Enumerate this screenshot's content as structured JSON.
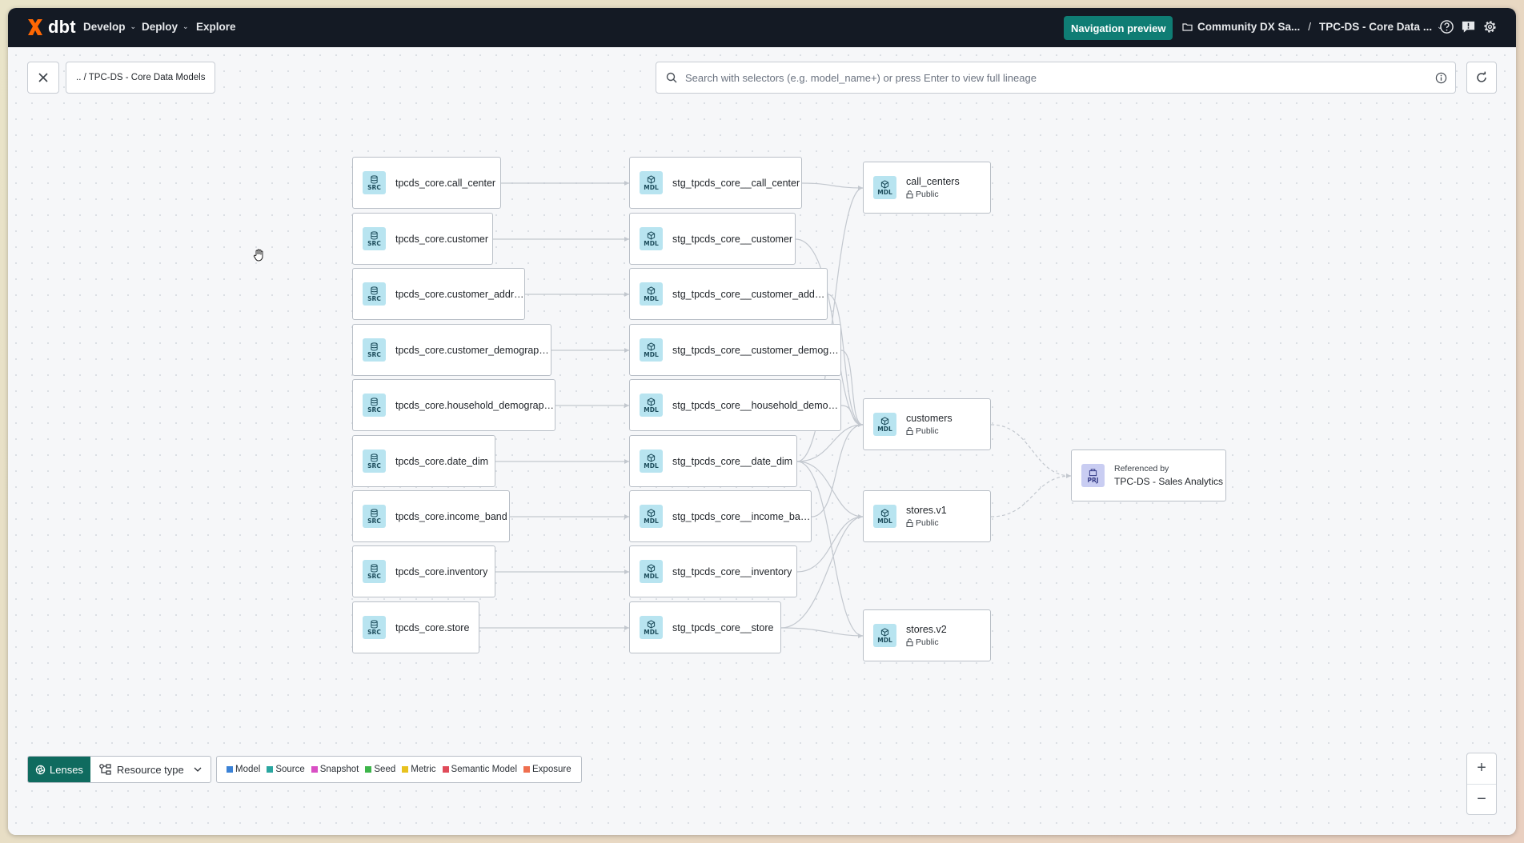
{
  "topnav": {
    "logo": "dbt",
    "menu": [
      {
        "label": "Develop",
        "has_dropdown": true
      },
      {
        "label": "Deploy",
        "has_dropdown": true
      },
      {
        "label": "Explore",
        "has_dropdown": false
      }
    ],
    "navigation_preview": "Navigation preview",
    "project": "Community DX Sa...",
    "separator": "/",
    "environment": "TPC-DS - Core Data ...",
    "icons": [
      "help-icon",
      "feedback-icon",
      "settings-icon"
    ]
  },
  "toolbar": {
    "breadcrumb": ".. / TPC-DS - Core Data Models",
    "search_placeholder": "Search with selectors (e.g. model_name+) or press Enter to view full lineage"
  },
  "badges": {
    "source": "SRC",
    "model": "MDL",
    "project": "PRJ"
  },
  "lineage": {
    "sources": [
      "tpcds_core.call_center",
      "tpcds_core.customer",
      "tpcds_core.customer_address",
      "tpcds_core.customer_demographics",
      "tpcds_core.household_demographics",
      "tpcds_core.date_dim",
      "tpcds_core.income_band",
      "tpcds_core.inventory",
      "tpcds_core.store"
    ],
    "staging_models": [
      "stg_tpcds_core__call_center",
      "stg_tpcds_core__customer",
      "stg_tpcds_core__customer_address",
      "stg_tpcds_core__customer_demogra...",
      "stg_tpcds_core__household_demogr...",
      "stg_tpcds_core__date_dim",
      "stg_tpcds_core__income_band",
      "stg_tpcds_core__inventory",
      "stg_tpcds_core__store"
    ],
    "public_models": [
      {
        "name": "call_centers",
        "access": "Public"
      },
      {
        "name": "customers",
        "access": "Public"
      },
      {
        "name": "stores.v1",
        "access": "Public"
      },
      {
        "name": "stores.v2",
        "access": "Public"
      }
    ],
    "referenced_by": {
      "label": "Referenced by",
      "project": "TPC-DS - Sales Analytics"
    }
  },
  "lenses": {
    "button": "Lenses",
    "resource_type": "Resource type"
  },
  "legend": [
    {
      "label": "Model",
      "color": "#3b82d6"
    },
    {
      "label": "Source",
      "color": "#2aa6a0"
    },
    {
      "label": "Snapshot",
      "color": "#d94fc4"
    },
    {
      "label": "Seed",
      "color": "#3db54a"
    },
    {
      "label": "Metric",
      "color": "#e8c21f"
    },
    {
      "label": "Semantic Model",
      "color": "#e04b5a"
    },
    {
      "label": "Exposure",
      "color": "#ef6f4f"
    }
  ],
  "zoom": {
    "in": "+",
    "out": "−"
  }
}
